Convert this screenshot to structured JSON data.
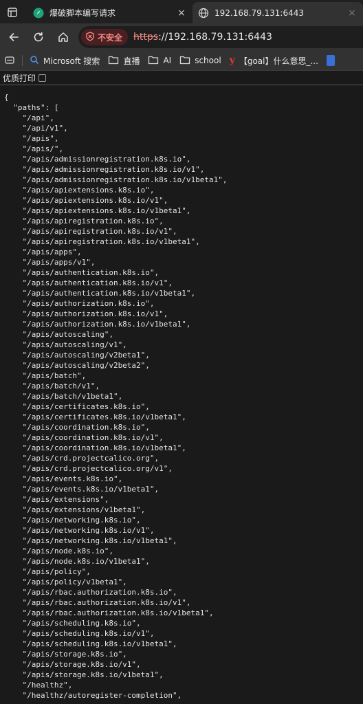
{
  "tabs": [
    {
      "title": "爆破脚本编写请求",
      "close": "×"
    },
    {
      "title": "192.168.79.131:6443",
      "close": "×"
    }
  ],
  "toolbar": {
    "security_label": "不安全",
    "url_scheme": "https",
    "url_rest": "://192.168.79.131:6443"
  },
  "bookmarks": [
    {
      "label": "Microsoft 搜索",
      "icon": "search-icon"
    },
    {
      "label": "直播",
      "icon": "folder-icon"
    },
    {
      "label": "AI",
      "icon": "folder-icon"
    },
    {
      "label": "school",
      "icon": "folder-icon"
    },
    {
      "label": "【goal】什么意思_...",
      "icon": "youdao-icon"
    }
  ],
  "page": {
    "pretty_print_label": "优质打印",
    "json_lines": [
      "{",
      "  \"paths\": [",
      "    \"/api\",",
      "    \"/api/v1\",",
      "    \"/apis\",",
      "    \"/apis/\",",
      "    \"/apis/admissionregistration.k8s.io\",",
      "    \"/apis/admissionregistration.k8s.io/v1\",",
      "    \"/apis/admissionregistration.k8s.io/v1beta1\",",
      "    \"/apis/apiextensions.k8s.io\",",
      "    \"/apis/apiextensions.k8s.io/v1\",",
      "    \"/apis/apiextensions.k8s.io/v1beta1\",",
      "    \"/apis/apiregistration.k8s.io\",",
      "    \"/apis/apiregistration.k8s.io/v1\",",
      "    \"/apis/apiregistration.k8s.io/v1beta1\",",
      "    \"/apis/apps\",",
      "    \"/apis/apps/v1\",",
      "    \"/apis/authentication.k8s.io\",",
      "    \"/apis/authentication.k8s.io/v1\",",
      "    \"/apis/authentication.k8s.io/v1beta1\",",
      "    \"/apis/authorization.k8s.io\",",
      "    \"/apis/authorization.k8s.io/v1\",",
      "    \"/apis/authorization.k8s.io/v1beta1\",",
      "    \"/apis/autoscaling\",",
      "    \"/apis/autoscaling/v1\",",
      "    \"/apis/autoscaling/v2beta1\",",
      "    \"/apis/autoscaling/v2beta2\",",
      "    \"/apis/batch\",",
      "    \"/apis/batch/v1\",",
      "    \"/apis/batch/v1beta1\",",
      "    \"/apis/certificates.k8s.io\",",
      "    \"/apis/certificates.k8s.io/v1beta1\",",
      "    \"/apis/coordination.k8s.io\",",
      "    \"/apis/coordination.k8s.io/v1\",",
      "    \"/apis/coordination.k8s.io/v1beta1\",",
      "    \"/apis/crd.projectcalico.org\",",
      "    \"/apis/crd.projectcalico.org/v1\",",
      "    \"/apis/events.k8s.io\",",
      "    \"/apis/events.k8s.io/v1beta1\",",
      "    \"/apis/extensions\",",
      "    \"/apis/extensions/v1beta1\",",
      "    \"/apis/networking.k8s.io\",",
      "    \"/apis/networking.k8s.io/v1\",",
      "    \"/apis/networking.k8s.io/v1beta1\",",
      "    \"/apis/node.k8s.io\",",
      "    \"/apis/node.k8s.io/v1beta1\",",
      "    \"/apis/policy\",",
      "    \"/apis/policy/v1beta1\",",
      "    \"/apis/rbac.authorization.k8s.io\",",
      "    \"/apis/rbac.authorization.k8s.io/v1\",",
      "    \"/apis/rbac.authorization.k8s.io/v1beta1\",",
      "    \"/apis/scheduling.k8s.io\",",
      "    \"/apis/scheduling.k8s.io/v1\",",
      "    \"/apis/scheduling.k8s.io/v1beta1\",",
      "    \"/apis/storage.k8s.io\",",
      "    \"/apis/storage.k8s.io/v1\",",
      "    \"/apis/storage.k8s.io/v1beta1\",",
      "    \"/healthz\",",
      "    \"/healthz/autoregister-completion\","
    ]
  },
  "colors": {
    "page_bg": "#1a1a1a",
    "tabstrip_bg": "#202020",
    "toolbar_bg": "#323232",
    "insecure_red": "#f28b82",
    "text": "#e4e4e4"
  }
}
